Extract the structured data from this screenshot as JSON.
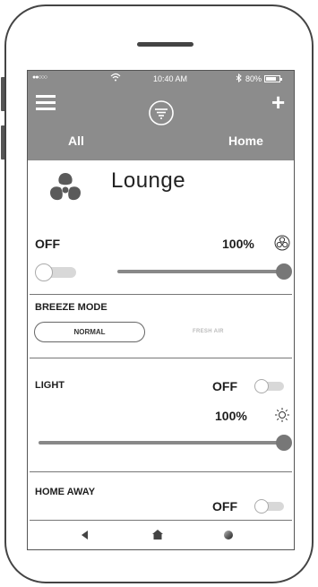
{
  "status_bar": {
    "carrier": "●●○○○",
    "wifi_icon": "wifi-icon",
    "time": "10:40 AM",
    "bluetooth": "∦",
    "battery_pct": "80%",
    "battery_level": 0.8
  },
  "header": {
    "menu_icon": "hamburger-icon",
    "logo_icon": "fan-logo-icon",
    "add_icon": "plus-icon",
    "add_label": "+",
    "tabs": [
      {
        "label": "All"
      },
      {
        "label": "Home"
      }
    ]
  },
  "room": {
    "icon": "fan-icon",
    "title": "Lounge"
  },
  "fan": {
    "state": "OFF",
    "power_on": false,
    "speed_pct": "100%",
    "speed_value": 100,
    "speed_icon": "fan-speed-icon"
  },
  "breeze": {
    "label": "BREEZE MODE",
    "options": [
      {
        "label": "NORMAL",
        "selected": true
      },
      {
        "label": "FRESH AIR",
        "selected": false
      }
    ]
  },
  "light": {
    "label": "LIGHT",
    "state": "OFF",
    "power_on": false,
    "brightness_pct": "100%",
    "brightness_value": 100,
    "icon": "sun-icon"
  },
  "home_away": {
    "label": "HOME AWAY",
    "state": "OFF",
    "enabled": false
  },
  "nav": {
    "back_icon": "back-icon",
    "home_icon": "home-icon",
    "recent_icon": "recent-icon"
  },
  "colors": {
    "header_bg": "#8c8c8c",
    "frame": "#444444",
    "slider": "#777777"
  }
}
